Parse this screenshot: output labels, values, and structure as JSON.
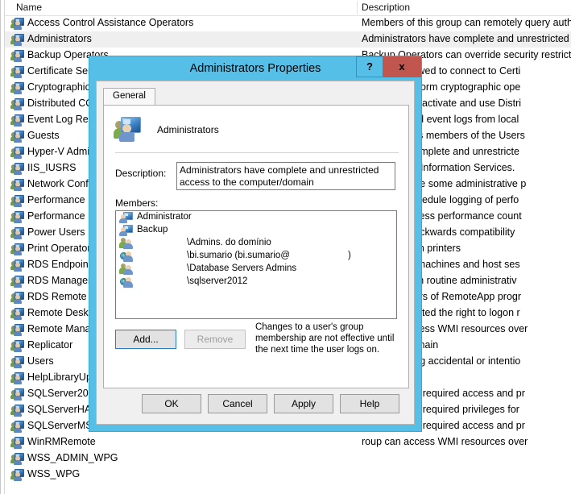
{
  "listview": {
    "columns": {
      "name": "Name",
      "description": "Description"
    },
    "rows": [
      {
        "name": "Access Control Assistance Operators",
        "desc": "Members of this group can remotely query authorizati",
        "icon": "group-icon",
        "selected": false
      },
      {
        "name": "Administrators",
        "desc": "Administrators have complete and unrestricted access",
        "icon": "group-icon",
        "selected": true
      },
      {
        "name": "Backup Operators",
        "desc": "Backup Operators can override security restrictions for",
        "icon": "group-icon",
        "selected": false
      },
      {
        "name": "Certificate Serv",
        "desc": "roup are allowed to connect to Certi",
        "icon": "group-icon",
        "selected": false
      },
      {
        "name": "Cryptographic",
        "desc": "orized to perform cryptographic ope",
        "icon": "group-icon",
        "selected": false
      },
      {
        "name": "Distributed CO",
        "desc": "ed to launch, activate and use Distri",
        "icon": "group-icon",
        "selected": false
      },
      {
        "name": "Event Log Read",
        "desc": "roup can read event logs from local",
        "icon": "group-icon",
        "selected": false
      },
      {
        "name": "Guests",
        "desc": "me access as members of the Users",
        "icon": "group-icon",
        "selected": false
      },
      {
        "name": "Hyper-V Admin",
        "desc": "roup have complete and unrestricte",
        "icon": "group-icon",
        "selected": false
      },
      {
        "name": "IIS_IUSRS",
        "desc": "d by Internet Information Services.",
        "icon": "group-icon",
        "selected": false
      },
      {
        "name": "Network Config",
        "desc": "roup can have some administrative p",
        "icon": "group-icon",
        "selected": false
      },
      {
        "name": "Performance Lo",
        "desc": "roup may schedule logging of perfo",
        "icon": "group-icon",
        "selected": false
      },
      {
        "name": "Performance M",
        "desc": "roup can access performance count",
        "icon": "group-icon",
        "selected": false
      },
      {
        "name": "Power Users",
        "desc": "cluded for backwards compatibility",
        "icon": "group-icon",
        "selected": false
      },
      {
        "name": "Print Operators",
        "desc": "inister domain printers",
        "icon": "group-icon",
        "selected": false
      },
      {
        "name": "RDS Endpoint S",
        "desc": "p run virtual machines and host ses",
        "icon": "group-icon",
        "selected": false
      },
      {
        "name": "RDS Managem",
        "desc": "p can perform routine administrativ",
        "icon": "group-icon",
        "selected": false
      },
      {
        "name": "RDS Remote Ac",
        "desc": "p enable users of RemoteApp progr",
        "icon": "group-icon",
        "selected": false
      },
      {
        "name": "Remote Deskto",
        "desc": "roup are granted the right to logon r",
        "icon": "group-icon",
        "selected": false
      },
      {
        "name": "Remote Manag",
        "desc": "roup can access WMI resources over",
        "icon": "group-icon",
        "selected": false
      },
      {
        "name": "Replicator",
        "desc": "ation in a domain",
        "icon": "group-icon",
        "selected": false
      },
      {
        "name": "Users",
        "desc": "d from making accidental or intentio",
        "icon": "group-icon",
        "selected": false
      },
      {
        "name": "HelpLibraryUpd",
        "desc": "",
        "icon": "group-icon",
        "selected": false
      },
      {
        "name": "SQLServer2005S",
        "desc": "oup have the required access and pr",
        "icon": "group-icon",
        "selected": false
      },
      {
        "name": "SQLServerHADI",
        "desc": "oup have the required privileges for",
        "icon": "group-icon",
        "selected": false
      },
      {
        "name": "SQLServerMSAS",
        "desc": "oup have the required access and pr",
        "icon": "group-icon",
        "selected": false
      },
      {
        "name": "WinRMRemote",
        "desc": "roup can access WMI resources over",
        "icon": "group-icon",
        "selected": false
      },
      {
        "name": "WSS_ADMIN_WPG",
        "desc": "",
        "icon": "group-icon",
        "selected": false
      },
      {
        "name": "WSS_WPG",
        "desc": "",
        "icon": "group-icon",
        "selected": false
      }
    ]
  },
  "dialog": {
    "title": "Administrators Properties",
    "help_button": "?",
    "close_button": "x",
    "tab": "General",
    "group_name": "Administrators",
    "description_label": "Description:",
    "description_value": "Administrators have complete and unrestricted access to the computer/domain",
    "members_label": "Members:",
    "members": [
      {
        "label": "Administrator",
        "icon": "user-icon",
        "indent": "near",
        "tail": ""
      },
      {
        "label": "Backup",
        "icon": "user-icon",
        "indent": "near",
        "tail": ""
      },
      {
        "label": "\\Admins. do domínio",
        "icon": "domain-group-icon",
        "indent": "far",
        "tail": ""
      },
      {
        "label": "\\bi.sumario (bi.sumario@",
        "icon": "domain-user-icon",
        "indent": "far",
        "tail": ")"
      },
      {
        "label": "\\Database Servers Admins",
        "icon": "domain-group-icon",
        "indent": "far",
        "tail": ""
      },
      {
        "label": "\\sqlserver2012",
        "icon": "domain-user-icon",
        "indent": "far",
        "tail": ""
      }
    ],
    "add_button": "Add...",
    "remove_button": "Remove",
    "hint": "Changes to a user's group membership are not effective until the next time the user logs on.",
    "ok_button": "OK",
    "cancel_button": "Cancel",
    "apply_button": "Apply",
    "help_footer_button": "Help"
  },
  "colors": {
    "title_bar": "#55bfe8",
    "close_button": "#c0564d",
    "dialog_face": "#f0f0f0",
    "selected_row": "#efefef"
  }
}
